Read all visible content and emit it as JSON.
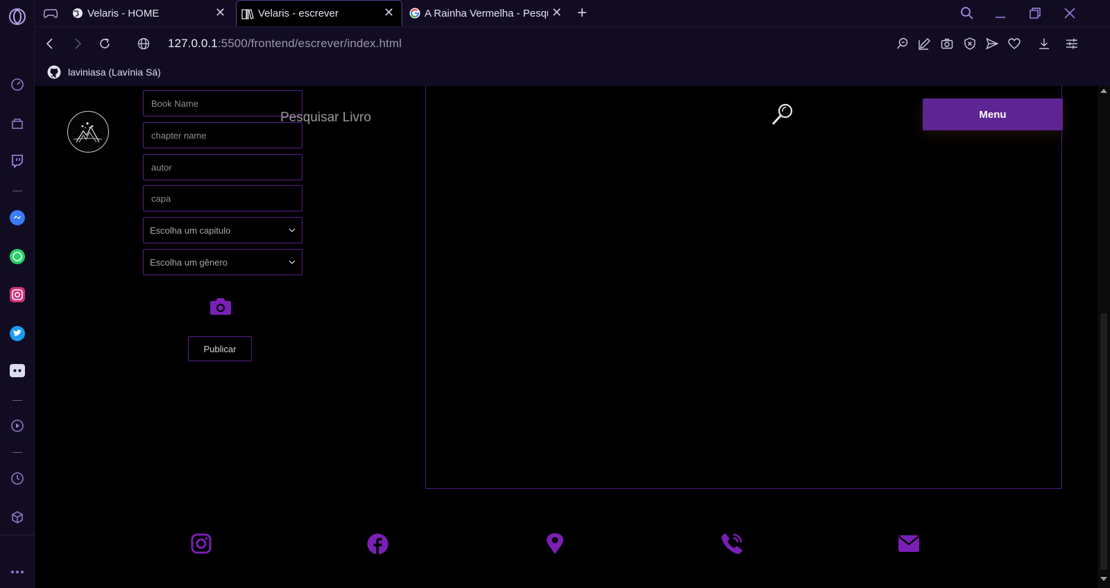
{
  "browser": {
    "tabs": [
      {
        "title": "Velaris - HOME"
      },
      {
        "title": "Velaris - escrever"
      },
      {
        "title": "A Rainha Vermelha - Pesqu"
      }
    ],
    "url_host": "127.0.0.1",
    "url_rest": ":5500/frontend/escrever/index.html",
    "bookmark": "laviniasa (Lavínia Sá)"
  },
  "page": {
    "search_label": "Pesquisar Livro",
    "fields": {
      "book_name": "Book Name",
      "chapter_name": "chapter name",
      "author": "autor",
      "cover": "capa"
    },
    "selects": {
      "chapter": "Escolha um capitulo",
      "genre": "Escolha um gênero"
    },
    "publish_label": "Publicar",
    "menu_label": "Menu"
  },
  "colors": {
    "accent": "#7a1fb5",
    "menu_button": "#5c2591",
    "border": "#5a1f8e",
    "browser_chrome": "#110c22"
  }
}
